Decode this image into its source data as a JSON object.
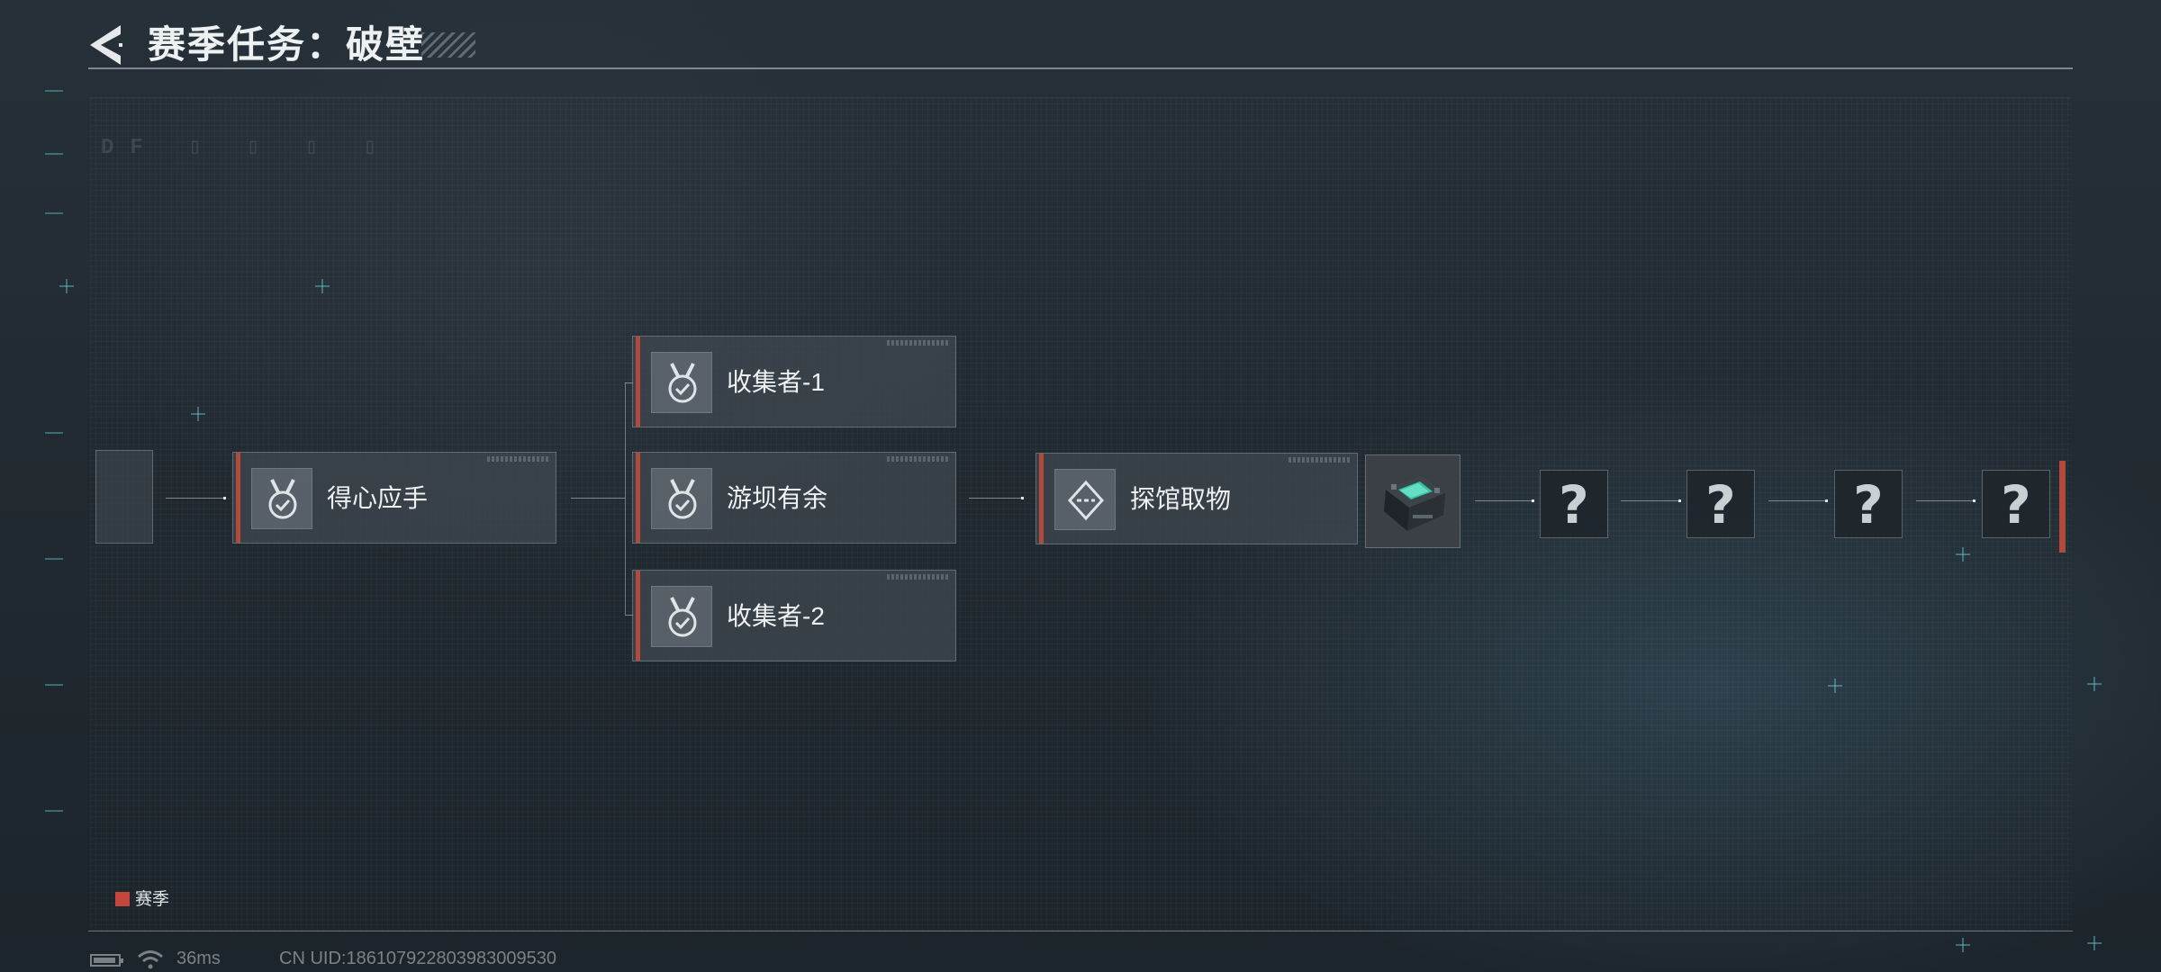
{
  "header": {
    "title": "赛季任务：破壁"
  },
  "nodes": {
    "node1": {
      "label": "得心应手",
      "icon": "medal-check-icon",
      "status": "completed"
    },
    "node2a": {
      "label": "收集者-1",
      "icon": "medal-check-icon",
      "status": "completed"
    },
    "node2b": {
      "label": "游坝有余",
      "icon": "medal-check-icon",
      "status": "completed"
    },
    "node2c": {
      "label": "收集者-2",
      "icon": "medal-check-icon",
      "status": "completed"
    },
    "node3": {
      "label": "探馆取物",
      "icon": "diamond-dash-icon",
      "status": "in-progress"
    }
  },
  "reward": {
    "icon": "reward-case-icon"
  },
  "locked_nodes": [
    {
      "symbol": "?"
    },
    {
      "symbol": "?"
    },
    {
      "symbol": "?"
    },
    {
      "symbol": "?"
    }
  ],
  "legend": {
    "label": "赛季",
    "color": "#c4463c"
  },
  "status_bar": {
    "ping": "36ms",
    "uid": "CN UID:1861079228039830095​30"
  },
  "colors": {
    "accent": "#b24a3b",
    "panel_bg": "#263038"
  }
}
